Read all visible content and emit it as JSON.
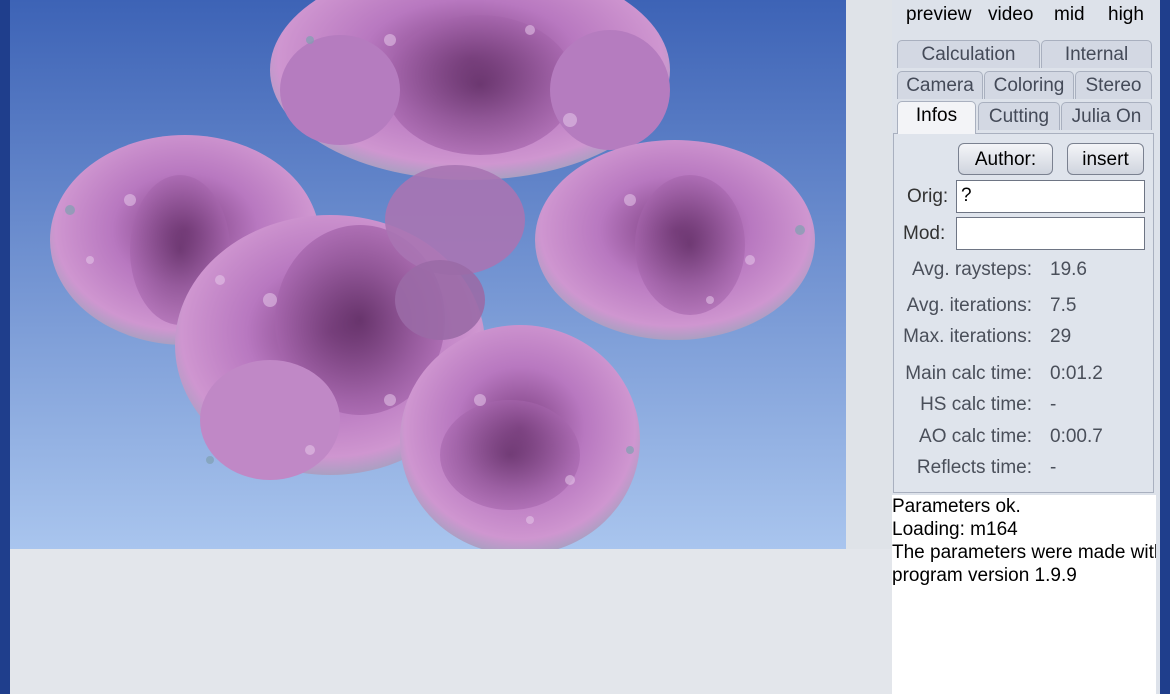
{
  "quality": {
    "preview": "preview",
    "video": "video",
    "mid": "mid",
    "high": "high"
  },
  "tabs": {
    "row1": [
      "Calculation",
      "Internal"
    ],
    "row2": [
      "Camera",
      "Coloring",
      "Stereo"
    ],
    "row3": [
      "Infos",
      "Cutting",
      "Julia On"
    ],
    "active": "Infos"
  },
  "infos": {
    "author_button": "Author:",
    "insert_button": "insert",
    "orig_label": "Orig:",
    "orig_value": "?",
    "mod_label": "Mod:",
    "mod_value": "",
    "stats": [
      {
        "label": "Avg. raysteps:",
        "value": "19.6"
      },
      {
        "label": "Avg. iterations:",
        "value": "7.5"
      },
      {
        "label": "Max. iterations:",
        "value": "29"
      },
      {
        "label": "Main calc time:",
        "value": "0:01.2"
      },
      {
        "label": "HS calc time:",
        "value": "-"
      },
      {
        "label": "AO calc time:",
        "value": "0:00.7"
      },
      {
        "label": "Reflects time:",
        "value": "-"
      }
    ]
  },
  "log": [
    "Parameters ok.",
    "Loading: m164",
    "The parameters were made with",
    "program version 1.9.9"
  ],
  "colors": {
    "sky_top": "#3f66b8",
    "sky_bottom": "#a8c4ec",
    "fractal": "#b070b8",
    "window_frame": "#1f3e8c"
  }
}
